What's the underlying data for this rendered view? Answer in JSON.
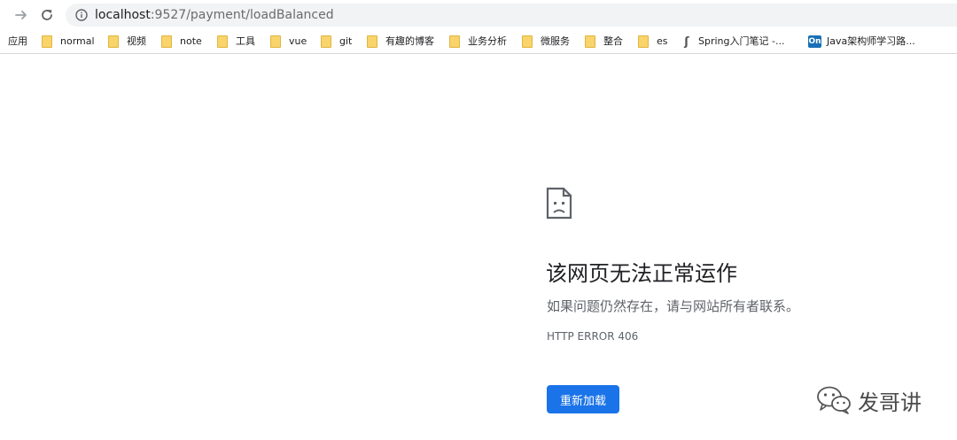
{
  "toolbar": {
    "forward_icon": "arrow-right-icon",
    "reload_icon": "reload-icon",
    "info_icon": "info-icon",
    "url_host": "localhost",
    "url_rest": ":9527/payment/loadBalanced"
  },
  "bookmarks": {
    "items": [
      {
        "label": "应用",
        "icon": "apps"
      },
      {
        "label": "normal",
        "icon": "folder"
      },
      {
        "label": "视频",
        "icon": "folder"
      },
      {
        "label": "note",
        "icon": "folder"
      },
      {
        "label": "工具",
        "icon": "folder"
      },
      {
        "label": "vue",
        "icon": "folder"
      },
      {
        "label": "git",
        "icon": "folder"
      },
      {
        "label": "有趣的博客",
        "icon": "folder"
      },
      {
        "label": "业务分析",
        "icon": "folder"
      },
      {
        "label": "微服务",
        "icon": "folder"
      },
      {
        "label": "整合",
        "icon": "folder"
      },
      {
        "label": "es",
        "icon": "folder"
      },
      {
        "label": "Spring入门笔记 -...",
        "icon": "spring-site"
      },
      {
        "label": "Java架构师学习路...",
        "icon": "on-site"
      }
    ],
    "on_icon_text": "On",
    "spring_icon_text": "ʃ"
  },
  "error": {
    "icon": "sad-page-icon",
    "title": "该网页无法正常运作",
    "description": "如果问题仍然存在，请与网站所有者联系。",
    "code": "HTTP ERROR 406",
    "reload_label": "重新加载"
  },
  "watermark": {
    "text": "发哥讲",
    "icon": "wechat-icon"
  },
  "colors": {
    "accent": "#1a73e8",
    "omnibox_bg": "#f1f3f4",
    "folder": "#f9d46b"
  }
}
